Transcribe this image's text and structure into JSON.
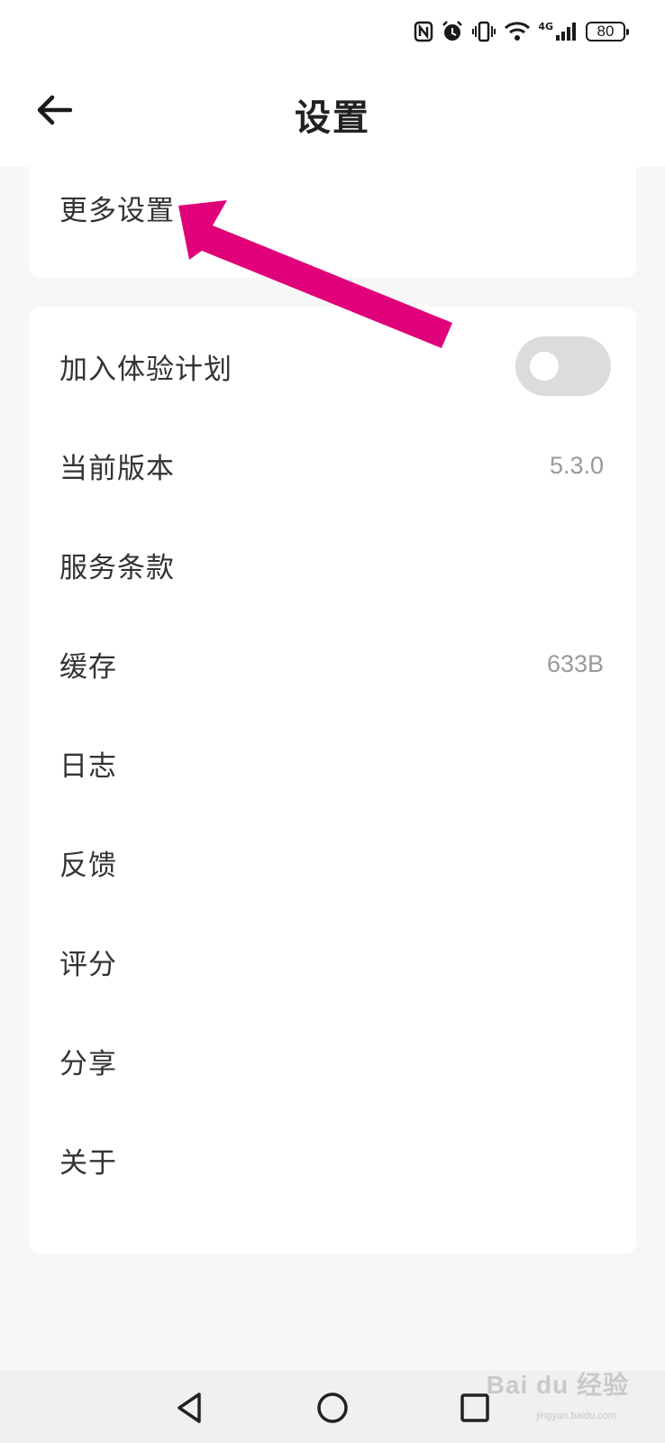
{
  "status_bar": {
    "network": "4G",
    "battery": "80",
    "icons": [
      "nfc-icon",
      "alarm-icon",
      "vibrate-icon",
      "wifi-icon",
      "signal-icon",
      "battery-icon"
    ]
  },
  "header": {
    "title": "设置",
    "back_icon": "arrow-left-icon"
  },
  "more_settings": {
    "label": "更多设置"
  },
  "settings": {
    "beta": {
      "label": "加入体验计划",
      "toggle_on": false
    },
    "version": {
      "label": "当前版本",
      "value": "5.3.0"
    },
    "terms": {
      "label": "服务条款"
    },
    "cache": {
      "label": "缓存",
      "value": "633B"
    },
    "log": {
      "label": "日志"
    },
    "feedback": {
      "label": "反馈"
    },
    "rate": {
      "label": "评分"
    },
    "share": {
      "label": "分享"
    },
    "about": {
      "label": "关于"
    }
  },
  "annotation": {
    "color": "#e0007a",
    "points_to": "more_settings"
  },
  "nav_bar": {
    "icons": [
      "back-triangle-icon",
      "home-circle-icon",
      "recents-square-icon"
    ]
  },
  "watermark": {
    "brand": "Bai du 经验",
    "url": "jingyan.baidu.com"
  },
  "colors": {
    "toggle_off": "#dcdcdc",
    "value_text": "#999999",
    "background": "#f7f7f7"
  }
}
